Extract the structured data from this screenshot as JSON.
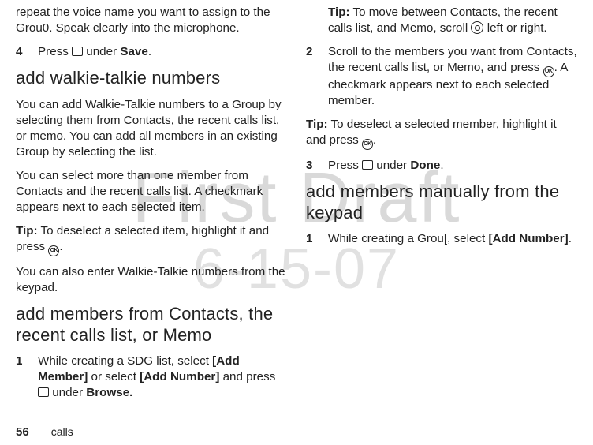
{
  "watermark": {
    "line1": "First Draft",
    "line2": "6-15-07"
  },
  "footer": {
    "pageNumber": "56",
    "section": "calls"
  },
  "left": {
    "intro_frag": "repeat the voice name you want to assign to the Grou0. Speak clearly into the microphone.",
    "step4_num": "4",
    "step4_a": "Press ",
    "step4_b": " under ",
    "step4_save": "Save",
    "h_add_wt": "add walkie-talkie numbers",
    "p1": "You can add Walkie-Talkie numbers to a Group by selecting them from Contacts, the recent calls list, or memo. You can add all members in an existing Group by selecting the list.",
    "p2": "You can select more than one member from Contacts and the recent calls list. A checkmark appears next to each selected item.",
    "tip1_label": "Tip:",
    "tip1_a": " To deselect a selected item, highlight it and press ",
    "p3": "You can also enter Walkie-Talkie numbers from the keypad."
  },
  "right": {
    "h_add_members": "add members from Contacts, the recent calls list, or Memo",
    "s1_num": "1",
    "s1_a": "While creating a SDG list, select ",
    "s1_add_member": "[Add Member]",
    "s1_b": " or select ",
    "s1_add_number": "[Add Number]",
    "s1_c": " and press ",
    "s1_d": " under ",
    "s1_browse": "Browse.",
    "s1_tip_label": "Tip:",
    "s1_tip_a": " To move between Contacts, the recent calls list, and Memo, scroll ",
    "s1_tip_b": " left or right.",
    "s2_num": "2",
    "s2_a": "Scroll to the members you want from Contacts, the recent calls list, or Memo, and press ",
    "s2_b": ". A checkmark appears next to each selected member.",
    "tip2_label": "Tip:",
    "tip2_a": " To deselect a selected member, highlight it and press ",
    "s3_num": "3",
    "s3_a": "Press ",
    "s3_b": " under ",
    "s3_done": "Done",
    "h_add_manual": "add members manually from the keypad",
    "m1_num": "1",
    "m1_a": "While creating a Grou[, select ",
    "m1_add_number": "[Add Number]"
  }
}
